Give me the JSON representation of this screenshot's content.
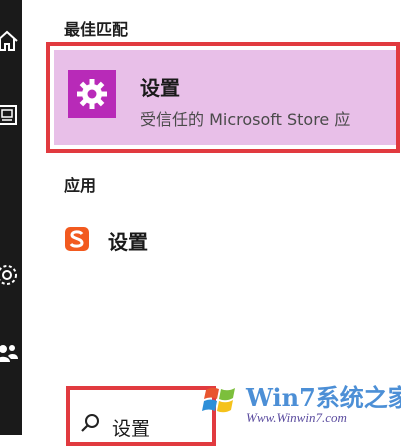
{
  "left_rail": {
    "icons": [
      "home-icon",
      "document-icon",
      "settings-icon",
      "people-icon"
    ],
    "background": "#1a1a1a"
  },
  "best_match": {
    "section_title": "最佳匹配",
    "app_name": "设置",
    "app_subtitle": "受信任的 Microsoft Store 应",
    "tile_color": "#b82ab8",
    "highlight_color": "#e8bfe8",
    "outline_color": "#e13a3f"
  },
  "apps": {
    "section_title": "应用",
    "items": [
      {
        "label": "设置",
        "icon": "sogou-icon",
        "icon_color": "#f25a1f"
      }
    ]
  },
  "search": {
    "value": "设置",
    "icon": "search-icon"
  },
  "watermark": {
    "brand": "Win7系统之家",
    "url": "Www.Winwin7.com"
  }
}
